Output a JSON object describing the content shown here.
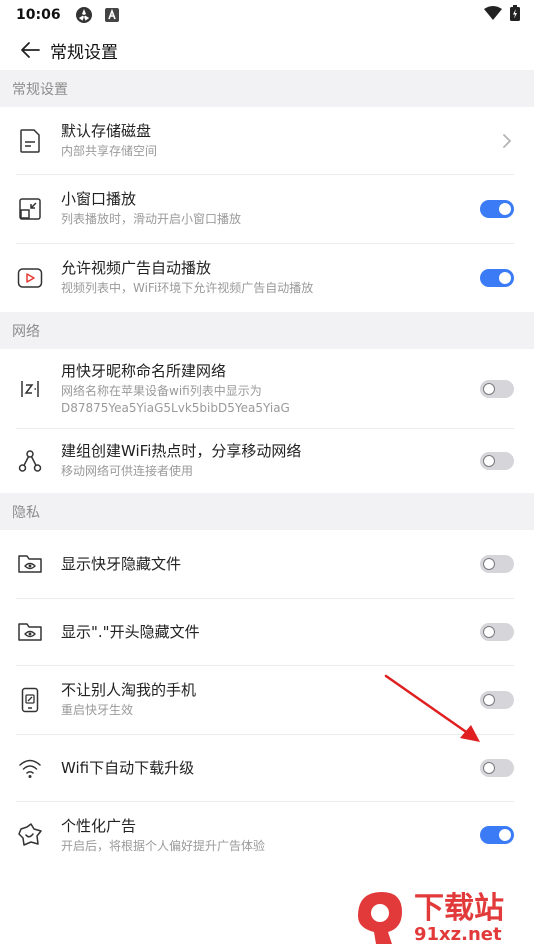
{
  "status_bar": {
    "time": "10:06"
  },
  "toolbar": {
    "title": "常规设置"
  },
  "sections": {
    "general": {
      "header": "常规设置"
    },
    "network": {
      "header": "网络"
    },
    "privacy": {
      "header": "隐私"
    }
  },
  "items": {
    "storage": {
      "title": "默认存储磁盘",
      "subtitle": "内部共享存储空间"
    },
    "pip": {
      "title": "小窗口播放",
      "subtitle": "列表播放时，滑动开启小窗口播放",
      "enabled": true
    },
    "video_ad": {
      "title": "允许视频广告自动播放",
      "subtitle": "视频列表中，WiFi环境下允许视频广告自动播放",
      "enabled": true
    },
    "nickname_net": {
      "title": "用快牙昵称命名所建网络",
      "subtitle": "网络名称在苹果设备wifi列表中显示为",
      "subtitle2": "D87875Yea5YiaG5Lvk5bibD5Yea5YiaG",
      "enabled": false
    },
    "hotspot_share": {
      "title": "建组创建WiFi热点时，分享移动网络",
      "subtitle": "移动网络可供连接者使用",
      "enabled": false
    },
    "hidden_files": {
      "title": "显示快牙隐藏文件",
      "enabled": false
    },
    "dot_files": {
      "title": "显示\".\"开头隐藏文件",
      "enabled": false
    },
    "anti_theft": {
      "title": "不让别人淘我的手机",
      "subtitle": "重启快牙生效",
      "enabled": false
    },
    "wifi_update": {
      "title": "Wifi下自动下载升级",
      "enabled": false
    },
    "personal_ads": {
      "title": "个性化广告",
      "subtitle": "开启后，将根据个人偏好提升广告体验",
      "enabled": true
    }
  },
  "watermark": {
    "text1": "下载站",
    "text2": "91xz.net"
  },
  "colors": {
    "toggle_on": "#3b7cf6",
    "toggle_off": "#d6d6da",
    "section_bg": "#f2f2f4",
    "annotation_arrow": "#e02020"
  }
}
